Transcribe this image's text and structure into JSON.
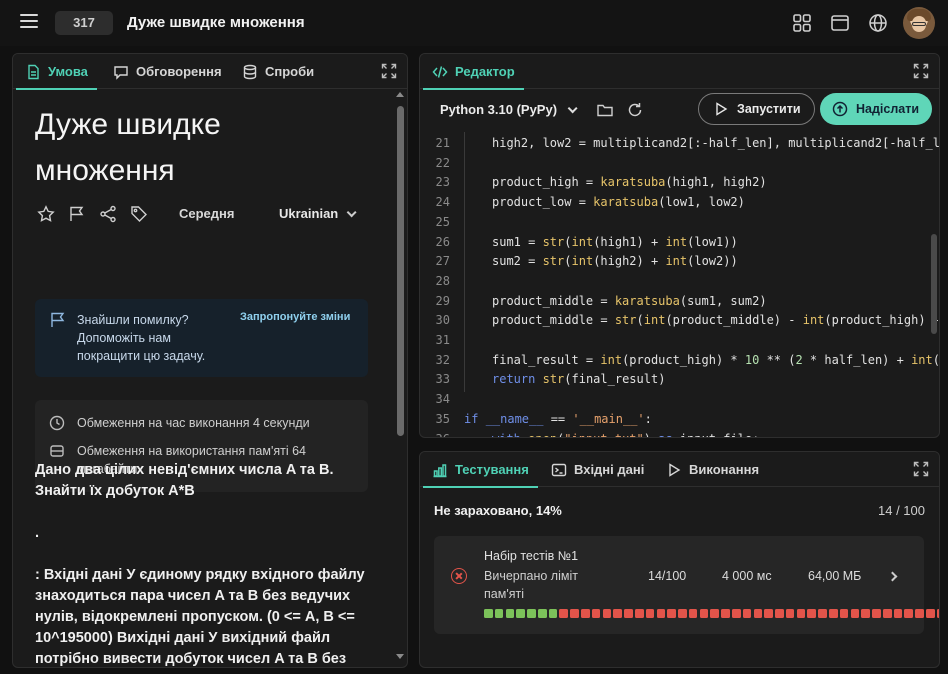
{
  "header": {
    "problem_number": "317",
    "problem_title": "Дуже швидке множення"
  },
  "left_panel": {
    "tabs": [
      {
        "label": "Умова",
        "icon": "document-icon",
        "active": true
      },
      {
        "label": "Обговорення",
        "icon": "chat-icon",
        "active": false
      },
      {
        "label": "Спроби",
        "icon": "database-icon",
        "active": false
      }
    ],
    "title_line1": "Дуже швидке",
    "title_line2": "множення",
    "difficulty": "Середня",
    "language": "Ukrainian",
    "report": {
      "text": "Знайшли помилку? Допоможіть нам покращити цю задачу.",
      "link": "Запропонуйте зміни"
    },
    "limits": {
      "time": "Обмеження на час виконання 4 секунди",
      "memory": "Обмеження на використання пам'яті 64 мегабайти"
    },
    "statement": {
      "p1": "Дано два цілих невід'ємних числа A та B. Знайти їх добуток A*B",
      "p2": ".",
      "p3": ": Вхідні дані У єдиному рядку вхідного файлу знаходиться пара чисел A та B без ведучих нулів, відокремлені пропуском. (0 <= A, B <= 10^195000) Вихідні дані У вихідний файл потрібно вивести добуток чисел A та B без"
    }
  },
  "editor": {
    "tab_label": "Редактор",
    "language": "Python 3.10 (PyPy)",
    "run_label": "Запустити",
    "submit_label": "Надіслати",
    "line_numbers": [
      "21",
      "22",
      "23",
      "24",
      "25",
      "26",
      "27",
      "28",
      "29",
      "30",
      "31",
      "32",
      "33",
      "34",
      "35",
      "36"
    ]
  },
  "testing": {
    "tabs": [
      {
        "label": "Тестування",
        "icon": "chart-icon",
        "active": true
      },
      {
        "label": "Вхідні дані",
        "icon": "terminal-icon",
        "active": false
      },
      {
        "label": "Виконання",
        "icon": "play-icon",
        "active": false
      }
    ],
    "verdict": "Не зараховано, 14%",
    "score": "14 / 100",
    "suite": {
      "title": "Набір тестів №1",
      "status": "Вичерпано ліміт пам'яті",
      "passed": "14/100",
      "time": "4 000 мс",
      "memory": "64,00 МБ"
    },
    "test_results": [
      "pass",
      "pass",
      "pass",
      "pass",
      "pass",
      "pass",
      "pass",
      "fail",
      "fail",
      "fail",
      "fail",
      "fail",
      "fail",
      "fail",
      "fail",
      "fail",
      "fail",
      "fail",
      "fail",
      "fail",
      "fail",
      "fail",
      "fail",
      "fail",
      "fail",
      "fail",
      "fail",
      "fail",
      "fail",
      "fail",
      "fail",
      "fail",
      "fail",
      "fail",
      "fail",
      "fail",
      "fail",
      "fail",
      "fail",
      "fail",
      "fail",
      "fail",
      "fail",
      "fail",
      "fail",
      "fail",
      "fail",
      "fail",
      "fail",
      "fail",
      "fail",
      "pending"
    ],
    "colors": {
      "pass": "#7cc25a",
      "fail": "#e2544a",
      "pending": "#3a3a3a"
    }
  }
}
